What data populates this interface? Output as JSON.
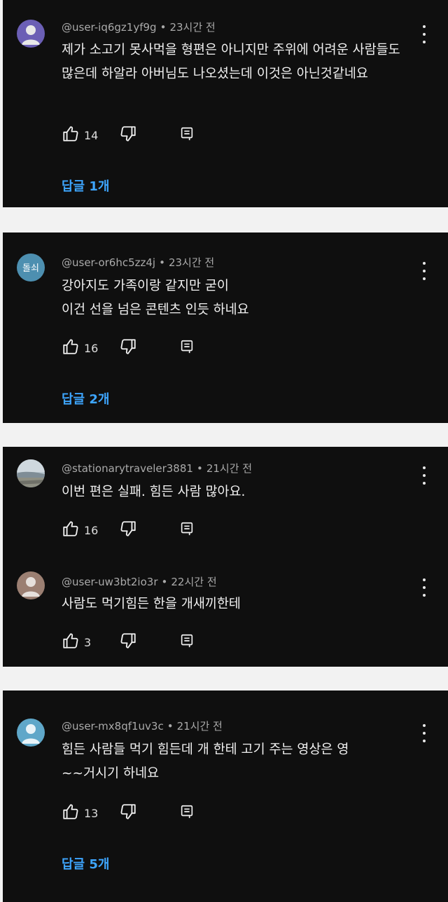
{
  "colors": {
    "card_background": "#0f0f0f",
    "page_background": "#f2f2f2",
    "text_primary": "#f1f1f1",
    "text_secondary": "#aaaaaa",
    "link": "#3ea6ff"
  },
  "icons": {
    "like": "thumb-up-icon",
    "dislike": "thumb-down-icon",
    "reply": "reply-icon",
    "more": "more-vert-icon"
  },
  "comments": [
    {
      "handle": "@user-iq6gz1yf9g",
      "separator": "•",
      "time": "23시간 전",
      "avatar_color": "#6b5fb5",
      "text": "제가 소고기 못사먹을 형편은 아니지만 주위에 어려운 사람들도 많은데 하알라  아버님도 나오셨는데 이것은 아닌것같네요",
      "likes": "14",
      "replies_label": "답글 1개"
    },
    {
      "handle": "@user-or6hc5zz4j",
      "separator": "•",
      "time": "23시간 전",
      "avatar_color": "#4d8fb0",
      "avatar_text": "돌쇠",
      "text": "강아지도 가족이랑 같지만 굳이\n이건 선을 넘은 콘텐츠 인듯 하네요",
      "likes": "16",
      "replies_label": "답글 2개"
    },
    {
      "handle": "@stationarytraveler3881",
      "separator": "•",
      "time": "21시간 전",
      "avatar_color": "#7f8d96",
      "text": "이번 편은 실패. 힘든 사람 많아요.",
      "likes": "16"
    },
    {
      "handle": "@user-uw3bt2io3r",
      "separator": "•",
      "time": "22시간 전",
      "avatar_color": "#9b7f72",
      "text": "사람도 먹기힘든 한을 개새끼한테",
      "likes": "3"
    },
    {
      "handle": "@user-mx8qf1uv3c",
      "separator": "•",
      "time": "21시간 전",
      "avatar_color": "#5fa7c9",
      "text": "힘든 사람들 먹기 힘든데 개 한테 고기 주는 영상은 영\n~~거시기 하네요",
      "likes": "13",
      "replies_label": "답글 5개"
    }
  ]
}
